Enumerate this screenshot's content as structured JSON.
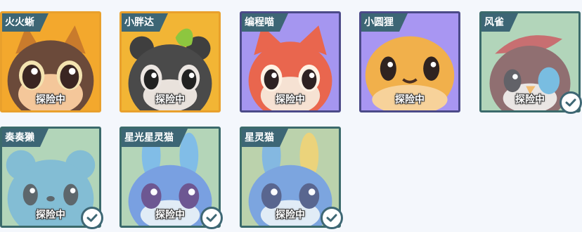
{
  "pets": [
    {
      "name": "火火蜥",
      "status": "探险中",
      "tint": "#f3a82d",
      "body": "#6b4a3a",
      "checked": false
    },
    {
      "name": "小胖达",
      "status": "探险中",
      "tint": "#f2b535",
      "body": "#4a4a4a",
      "checked": false
    },
    {
      "name": "编程喵",
      "status": "探险中",
      "tint": "#a596f0",
      "body": "#e9664e",
      "checked": false
    },
    {
      "name": "小圆狸",
      "status": "探险中",
      "tint": "#a896f2",
      "body": "#f1b04b",
      "checked": false
    },
    {
      "name": "风雀",
      "status": "探险中",
      "tint": "#9ac9a2",
      "body": "#6a3c3d",
      "checked": true
    },
    {
      "name": "奏奏獭",
      "status": "探险中",
      "tint": "#9ac8a0",
      "body": "#58a7c6",
      "checked": true
    },
    {
      "name": "星光星灵猫",
      "status": "探险中",
      "tint": "#9cc89f",
      "body": "#4b7fd8",
      "checked": true
    },
    {
      "name": "星灵猫",
      "status": "探险中",
      "tint": "#a6c58e",
      "body": "#4f86d4",
      "checked": true
    }
  ],
  "icons": {
    "check": "check-circle-icon"
  },
  "colors": {
    "frame": "#3e6774",
    "tag": "#3d6675"
  }
}
